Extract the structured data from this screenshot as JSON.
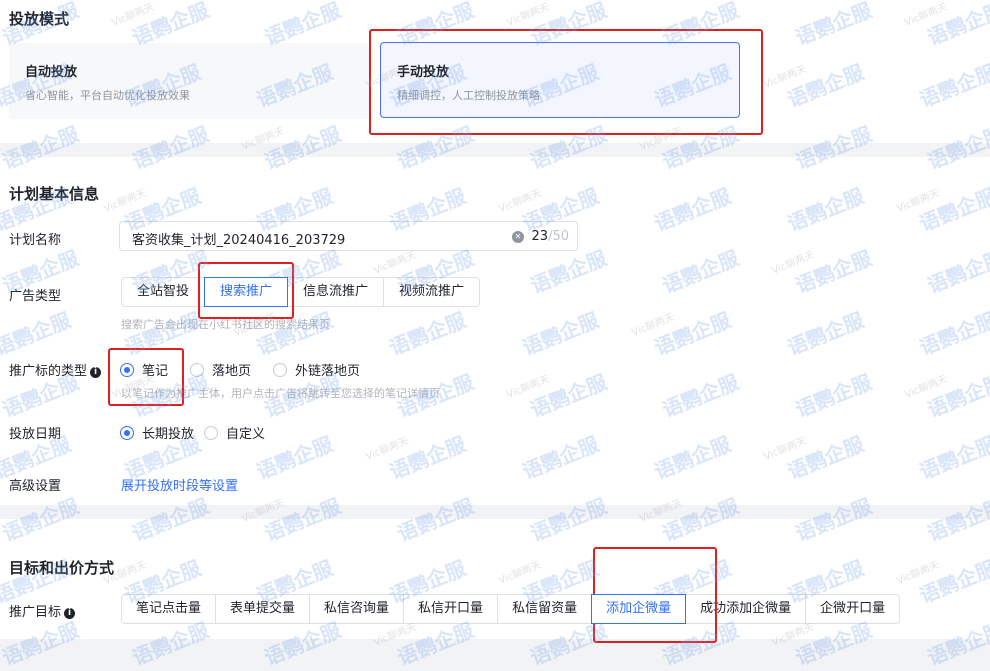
{
  "delivery_mode": {
    "title": "投放模式",
    "auto": {
      "title": "自动投放",
      "desc": "省心智能，平台自动优化投放效果"
    },
    "manual": {
      "title": "手动投放",
      "desc": "精细调控，人工控制投放策略",
      "selected": true
    }
  },
  "basic_info": {
    "title": "计划基本信息",
    "plan_name": {
      "label": "计划名称",
      "value": "客资收集_计划_20240416_203729",
      "count": "23",
      "separator": "/",
      "max": "50"
    },
    "ad_type": {
      "label": "广告类型",
      "options": [
        "全站智投",
        "搜索推广",
        "信息流推广",
        "视频流推广"
      ],
      "selected": "搜索推广",
      "hint": "搜索广告会出现在小红书社区的搜索结果页"
    },
    "target_type": {
      "label": "推广标的类型",
      "options": [
        "笔记",
        "落地页",
        "外链落地页"
      ],
      "selected": "笔记",
      "hint": "以笔记作为推广主体，用户点击广告将跳转至您选择的笔记详情页"
    },
    "schedule": {
      "label": "投放日期",
      "options": [
        "长期投放",
        "自定义"
      ],
      "selected": "长期投放"
    },
    "advanced": {
      "label": "高级设置",
      "link": "展开投放时段等设置"
    }
  },
  "bidding": {
    "title": "目标和出价方式",
    "goal": {
      "label": "推广目标",
      "options": [
        "笔记点击量",
        "表单提交量",
        "私信咨询量",
        "私信开口量",
        "私信留资量",
        "添加企微量",
        "成功添加企微量",
        "企微开口量"
      ],
      "selected": "添加企微量"
    }
  },
  "watermark": {
    "text": "语鹦企服",
    "sub": "Vic聊两天"
  },
  "colors": {
    "accent": "#3370ff",
    "highlight_box": "#e02020",
    "background": "#f2f3f5"
  }
}
